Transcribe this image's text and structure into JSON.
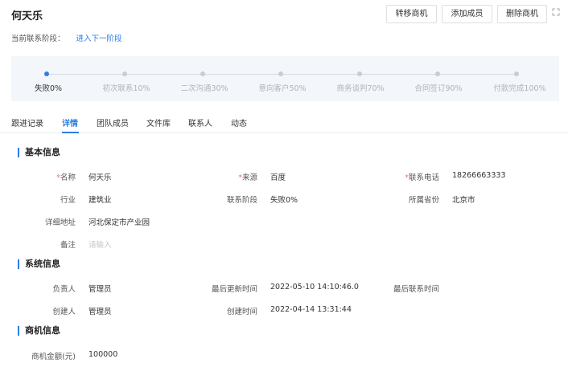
{
  "header": {
    "title": "何天乐",
    "buttons": {
      "transfer": "转移商机",
      "add_member": "添加成员",
      "delete": "删除商机"
    }
  },
  "stage": {
    "label": "当前联系阶段：",
    "next_link": "进入下一阶段"
  },
  "progress": {
    "steps": [
      "失败0%",
      "初次联系10%",
      "二次沟通30%",
      "意向客户50%",
      "商务谈判70%",
      "合同签订90%",
      "付款完成100%"
    ],
    "active_index": 0
  },
  "tabs": [
    "跟进记录",
    "详情",
    "团队成员",
    "文件库",
    "联系人",
    "动态"
  ],
  "active_tab": 1,
  "sections": {
    "basic": {
      "title": "基本信息",
      "name_label": "名称",
      "name_value": "何天乐",
      "source_label": "来源",
      "source_value": "百度",
      "phone_label": "联系电话",
      "phone_value": "18266663333",
      "industry_label": "行业",
      "industry_value": "建筑业",
      "stage_label": "联系阶段",
      "stage_value": "失败0%",
      "province_label": "所属省份",
      "province_value": "北京市",
      "address_label": "详细地址",
      "address_value": "河北保定市产业园",
      "note_label": "备注",
      "note_placeholder": "请输入"
    },
    "system": {
      "title": "系统信息",
      "owner_label": "负责人",
      "owner_value": "管理员",
      "updated_label": "最后更新时间",
      "updated_value": "2022-05-10 14:10:46.0",
      "last_contact_label": "最后联系时间",
      "last_contact_value": "",
      "creator_label": "创建人",
      "creator_value": "管理员",
      "created_label": "创建时间",
      "created_value": "2022-04-14 13:31:44"
    },
    "opportunity": {
      "title": "商机信息",
      "amount_label": "商机金额(元)",
      "amount_value": "100000"
    }
  },
  "colors": {
    "accent": "#2d7fe0",
    "required": "#f56c6c",
    "progress_bg": "#f3f6fa"
  }
}
